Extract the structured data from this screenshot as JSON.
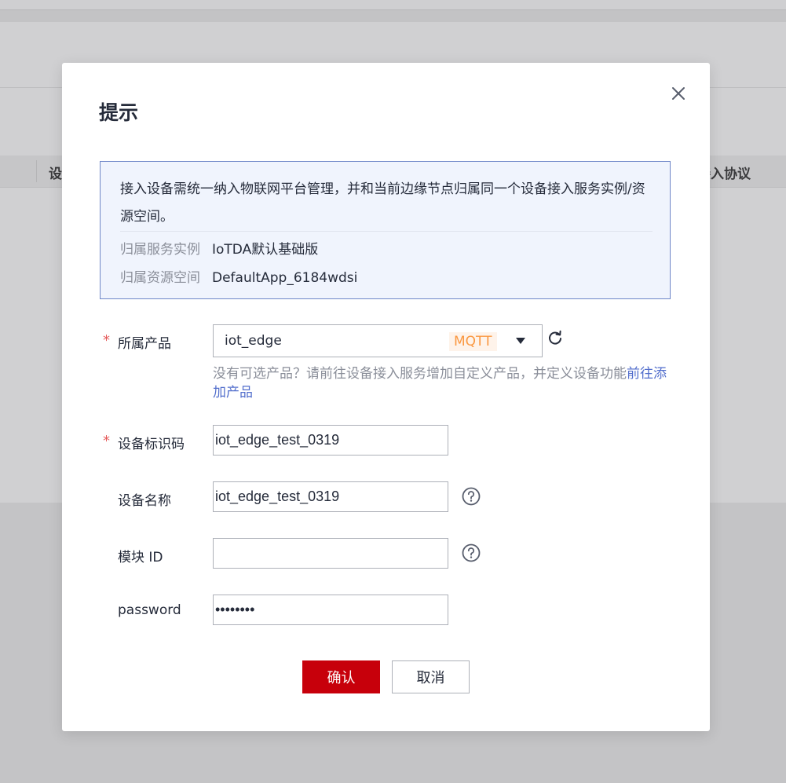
{
  "background": {
    "table_header_left": "设",
    "table_header_right": "接入协议"
  },
  "dialog": {
    "title": "提示",
    "close_icon": "close-icon",
    "info": {
      "text": "接入设备需统一纳入物联网平台管理，并和当前边缘节点归属同一个设备接入服务实例/资源空间。",
      "service_instance_label": "归属服务实例",
      "service_instance_value": "IoTDA默认基础版",
      "resource_space_label": "归属资源空间",
      "resource_space_value": "DefaultApp_6184wdsi"
    },
    "form": {
      "required_mark": "*",
      "product": {
        "label": "所属产品",
        "value": "iot_edge",
        "protocol_badge": "MQTT",
        "hint_text": "没有可选产品？请前往设备接入服务增加自定义产品，并定义设备功能",
        "hint_link": "前往添加产品"
      },
      "device_identifier": {
        "label": "设备标识码",
        "value": "iot_edge_test_0319"
      },
      "device_name": {
        "label": "设备名称",
        "value": "iot_edge_test_0319"
      },
      "module_id": {
        "label": "模块 ID",
        "value": ""
      },
      "password": {
        "label": "password",
        "value": "12345678"
      }
    },
    "buttons": {
      "confirm": "确认",
      "cancel": "取消"
    }
  },
  "colors": {
    "primary_button": "#c7000b",
    "link": "#526ecc",
    "required": "#e55a5a",
    "badge_text": "#fa9841",
    "info_border": "#6e86c7"
  }
}
